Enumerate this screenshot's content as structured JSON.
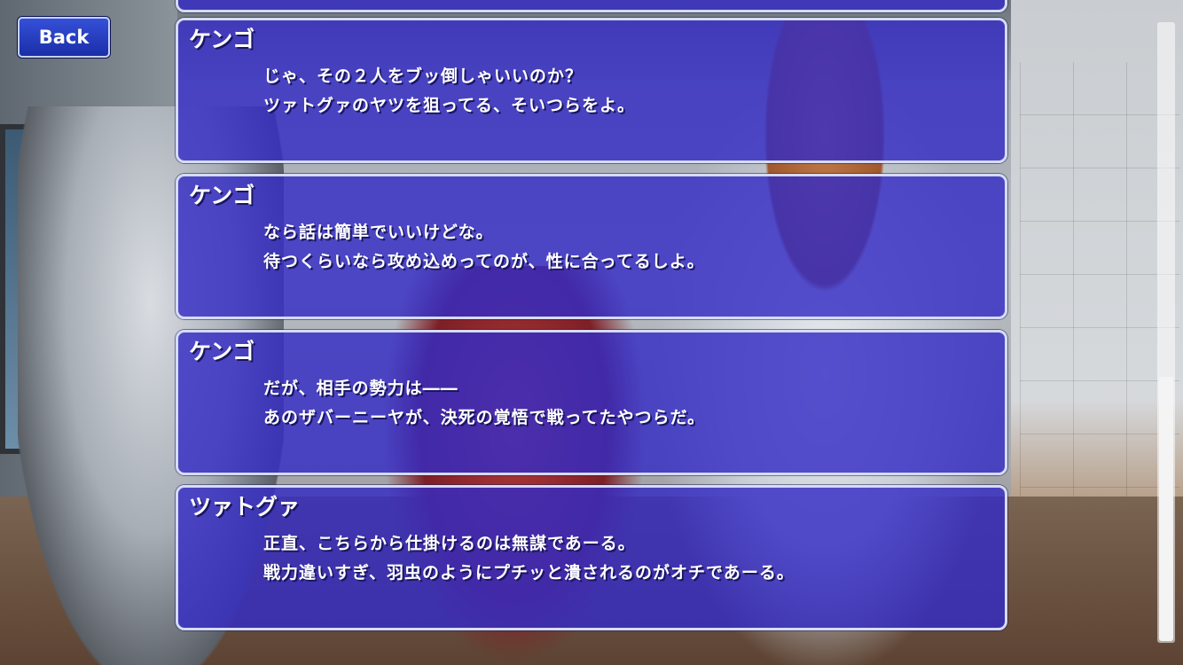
{
  "back_button": {
    "label": "Back"
  },
  "log": [
    {
      "speaker": "ケンゴ",
      "lines": [
        "じゃ、その２人をブッ倒しゃいいのか？",
        "ツァトグァのヤツを狙ってる、そいつらをよ。"
      ]
    },
    {
      "speaker": "ケンゴ",
      "lines": [
        "なら話は簡単でいいけどな。",
        "待つくらいなら攻め込めってのが、性に合ってるしよ。"
      ]
    },
    {
      "speaker": "ケンゴ",
      "lines": [
        "だが、相手の勢力は――",
        "あのザバーニーヤが、決死の覚悟で戦ってたやつらだ。"
      ]
    },
    {
      "speaker": "ツァトグァ",
      "lines": [
        "正直、こちらから仕掛けるのは無謀であーる。",
        "戦力違いすぎ、羽虫のようにプチッと潰されるのがオチであーる。"
      ]
    }
  ],
  "colors": {
    "panel": "#342cc4",
    "panel_border": "#d6dbf5",
    "button": "#1a2ea8",
    "text": "#ffffff"
  }
}
